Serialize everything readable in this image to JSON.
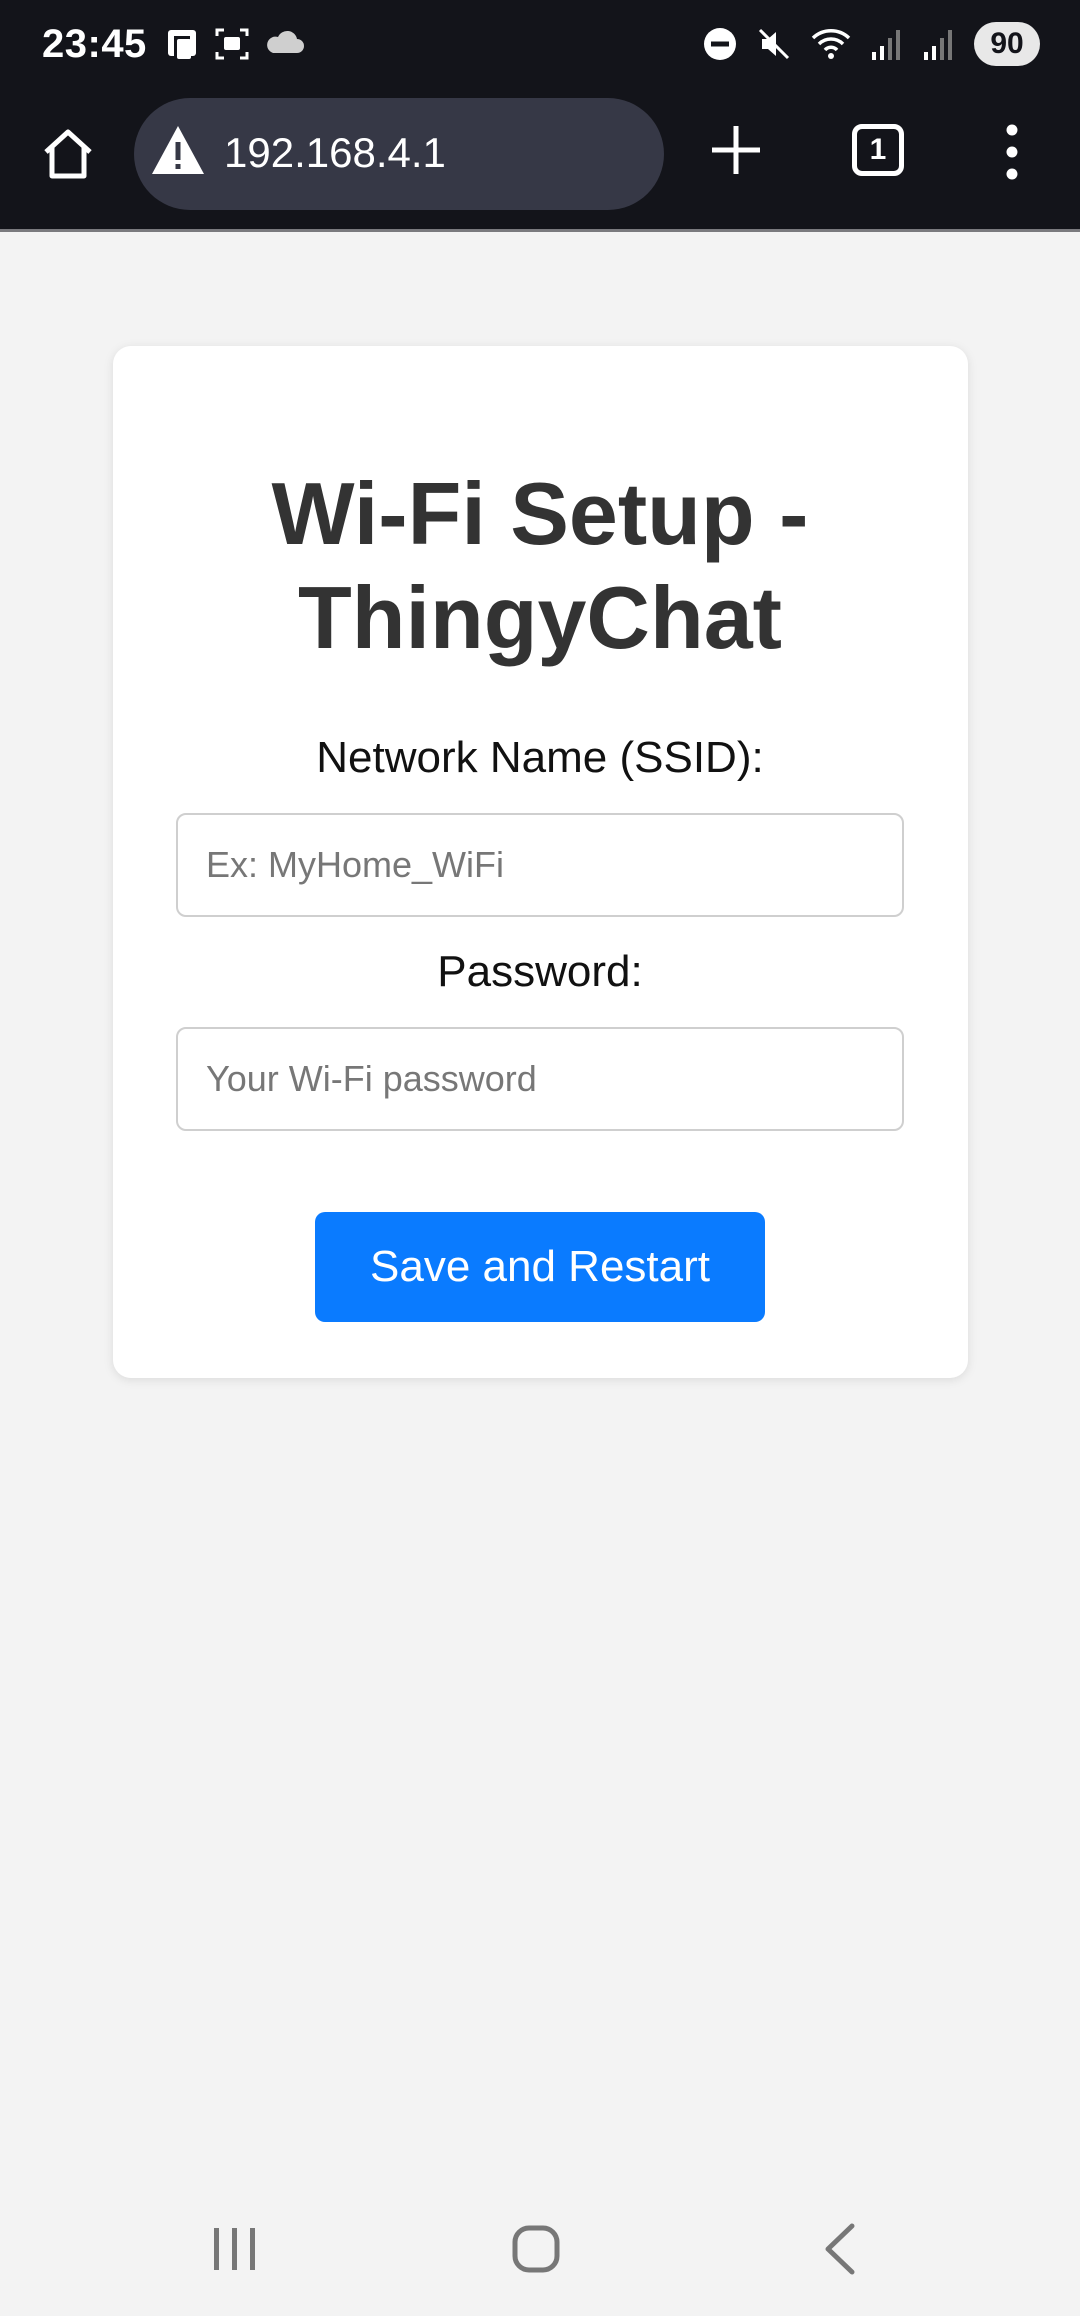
{
  "status_bar": {
    "time": "23:45",
    "battery": "90",
    "left_icons": [
      "phone-icon",
      "screenshot-icon",
      "cloud-icon"
    ],
    "right_icons": [
      "dnd-icon",
      "mute-icon",
      "wifi-icon",
      "signal-icon",
      "signal-icon"
    ]
  },
  "browser": {
    "url": "192.168.4.1",
    "tab_count": "1",
    "icons": [
      "home-icon",
      "warning-icon",
      "plus-icon",
      "tabs-icon",
      "menu-icon"
    ]
  },
  "page": {
    "title_line1": "Wi-Fi Setup -",
    "title_line2": "ThingyChat",
    "ssid_label": "Network Name (SSID):",
    "ssid_placeholder": "Ex: MyHome_WiFi",
    "password_label": "Password:",
    "password_placeholder": "Your Wi-Fi password",
    "submit_label": "Save and Restart"
  },
  "colors": {
    "accent": "#0a7bff",
    "background": "#f3f3f3",
    "chrome": "#13141a"
  }
}
